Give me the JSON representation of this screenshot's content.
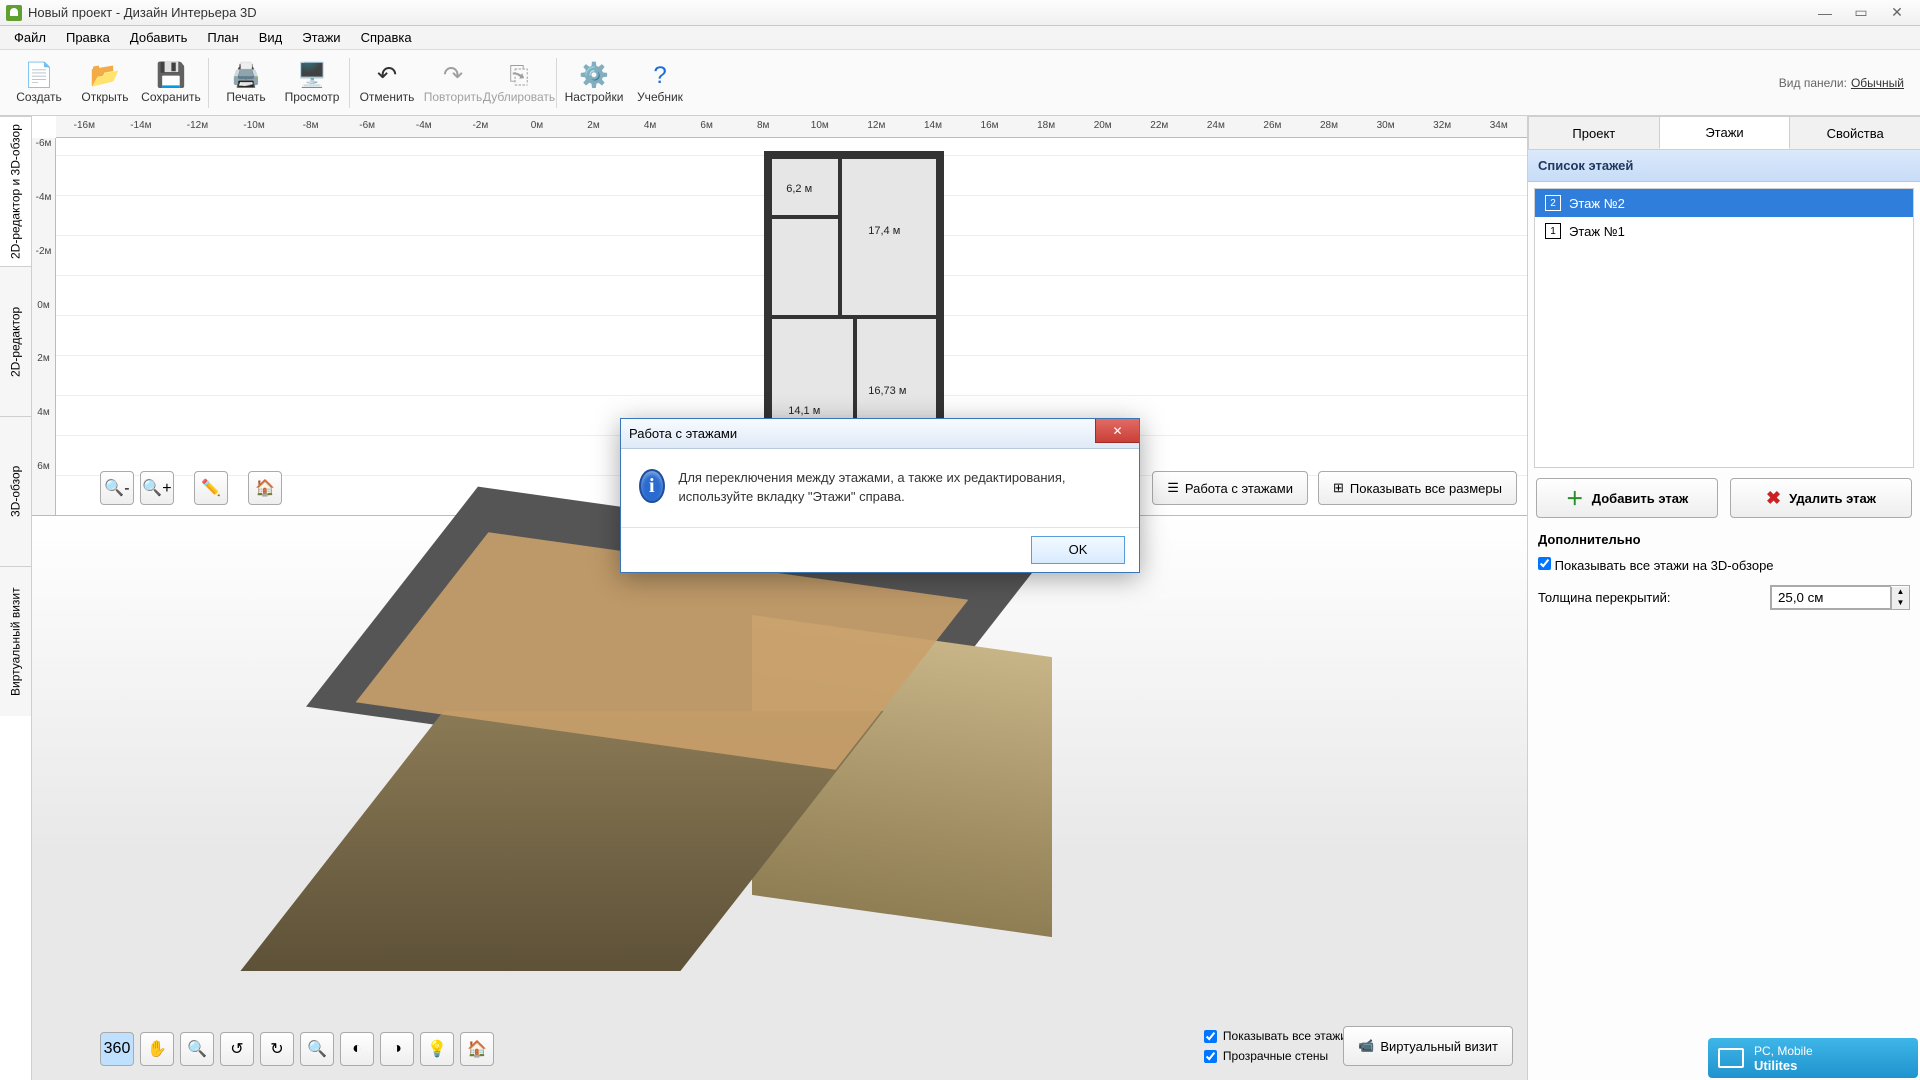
{
  "titlebar": {
    "title": "Новый проект - Дизайн Интерьера 3D"
  },
  "menu": [
    "Файл",
    "Правка",
    "Добавить",
    "План",
    "Вид",
    "Этажи",
    "Справка"
  ],
  "toolbar": {
    "create": "Создать",
    "open": "Открыть",
    "save": "Сохранить",
    "print": "Печать",
    "preview": "Просмотр",
    "undo": "Отменить",
    "redo": "Повторить",
    "duplicate": "Дублировать",
    "settings": "Настройки",
    "tutorial": "Учебник",
    "view_panel_label": "Вид панели:",
    "view_panel_value": "Обычный"
  },
  "vtabs": [
    "2D-редактор и 3D-обзор",
    "2D-редактор",
    "3D-обзор",
    "Виртуальный визит"
  ],
  "ruler_h": [
    "-16м",
    "-14м",
    "-12м",
    "-10м",
    "-8м",
    "-6м",
    "-4м",
    "-2м",
    "0м",
    "2м",
    "4м",
    "6м",
    "8м",
    "10м",
    "12м",
    "14м",
    "16м",
    "18м",
    "20м",
    "22м",
    "24м",
    "26м",
    "28м",
    "30м",
    "32м",
    "34м"
  ],
  "ruler_v": [
    "-6м",
    "-4м",
    "-2м",
    "0м",
    "2м",
    "4м",
    "6м"
  ],
  "rooms": {
    "a": "6,2 м",
    "b": "17,4 м",
    "c": "14,1 м",
    "d": "16,73 м"
  },
  "plan_toolbar": {
    "work_floors": "Работа с этажами",
    "show_sizes": "Показывать все размеры"
  },
  "bottom": {
    "show_all_floors": "Показывать все этажи",
    "transparent": "Прозрачные стены",
    "virtual": "Виртуальный визит"
  },
  "rpanel": {
    "tabs": {
      "project": "Проект",
      "floors": "Этажи",
      "props": "Свойства"
    },
    "list_header": "Список этажей",
    "floors": [
      {
        "label": "Этаж №2",
        "sel": true
      },
      {
        "label": "Этаж №1",
        "sel": false
      }
    ],
    "add": "Добавить этаж",
    "delete": "Удалить этаж",
    "extra": "Дополнительно",
    "show3d": "Показывать все этажи на 3D-обзоре",
    "thickness_label": "Толщина перекрытий:",
    "thickness_value": "25,0 см"
  },
  "dialog": {
    "title": "Работа с этажами",
    "text": "Для переключения между этажами, а также их редактирования, используйте вкладку \"Этажи\" справа.",
    "ok": "OK"
  },
  "footer_badge": {
    "line1": "PC, Mobile",
    "line2": "Utilites"
  }
}
